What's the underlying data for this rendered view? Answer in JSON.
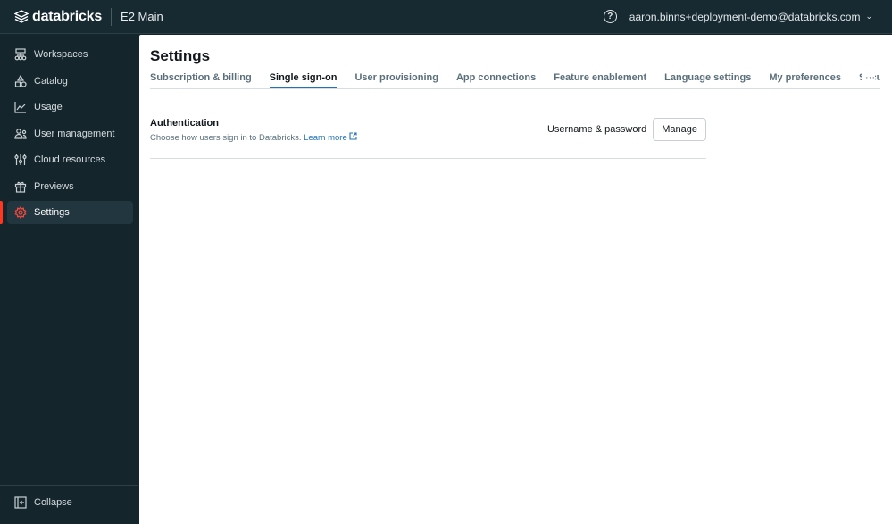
{
  "header": {
    "brand": "databricks",
    "workspace": "E2 Main",
    "help_icon": "question-circle-icon",
    "user_email": "aaron.binns+deployment-demo@databricks.com"
  },
  "sidebar": {
    "items": [
      {
        "label": "Workspaces",
        "icon": "workspaces-icon"
      },
      {
        "label": "Catalog",
        "icon": "catalog-icon"
      },
      {
        "label": "Usage",
        "icon": "chart-line-icon"
      },
      {
        "label": "User management",
        "icon": "users-icon"
      },
      {
        "label": "Cloud resources",
        "icon": "sliders-icon"
      },
      {
        "label": "Previews",
        "icon": "gift-icon"
      },
      {
        "label": "Settings",
        "icon": "gear-icon",
        "active": true
      }
    ],
    "collapse_label": "Collapse"
  },
  "main": {
    "title": "Settings",
    "tabs": [
      {
        "label": "Subscription & billing"
      },
      {
        "label": "Single sign-on",
        "active": true
      },
      {
        "label": "User provisioning"
      },
      {
        "label": "App connections"
      },
      {
        "label": "Feature enablement"
      },
      {
        "label": "Language settings"
      },
      {
        "label": "My preferences"
      },
      {
        "label": "Security a"
      }
    ],
    "more_label": "···",
    "authentication": {
      "title": "Authentication",
      "description": "Choose how users sign in to Databricks.",
      "learn_more": "Learn more",
      "method": "Username & password",
      "manage_label": "Manage"
    }
  },
  "colors": {
    "accent": "#2272b4",
    "active_indicator": "#ff3621",
    "sidebar_bg": "#14252c"
  }
}
